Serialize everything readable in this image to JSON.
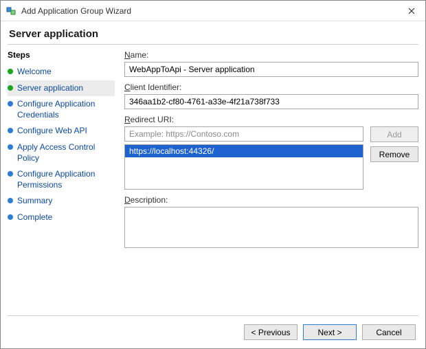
{
  "window": {
    "title": "Add Application Group Wizard"
  },
  "header": "Server application",
  "sidebar": {
    "title": "Steps",
    "items": [
      {
        "label": "Welcome",
        "state": "done",
        "current": false
      },
      {
        "label": "Server application",
        "state": "done",
        "current": true
      },
      {
        "label": "Configure Application Credentials",
        "state": "todo",
        "current": false
      },
      {
        "label": "Configure Web API",
        "state": "todo",
        "current": false
      },
      {
        "label": "Apply Access Control Policy",
        "state": "todo",
        "current": false
      },
      {
        "label": "Configure Application Permissions",
        "state": "todo",
        "current": false
      },
      {
        "label": "Summary",
        "state": "todo",
        "current": false
      },
      {
        "label": "Complete",
        "state": "todo",
        "current": false
      }
    ]
  },
  "form": {
    "name_label_pre": "N",
    "name_label_post": "ame:",
    "name_value": "WebAppToApi - Server application",
    "clientid_label_pre": "C",
    "clientid_label_post": "lient Identifier:",
    "clientid_value": "346aa1b2-cf80-4761-a33e-4f21a738f733",
    "redirect_label_pre": "R",
    "redirect_label_post": "edirect URI:",
    "redirect_placeholder": "Example: https://Contoso.com",
    "redirect_input_value": "",
    "redirect_list": [
      {
        "value": "https://localhost:44326/",
        "selected": true
      }
    ],
    "add_btn": "Add",
    "add_btn_ul": "A",
    "remove_btn": "emove",
    "remove_btn_ul": "R",
    "desc_label_pre": "D",
    "desc_label_post": "escription:",
    "desc_value": ""
  },
  "footer": {
    "prev": "< Previous",
    "next": "Next >",
    "cancel": "Cancel"
  }
}
